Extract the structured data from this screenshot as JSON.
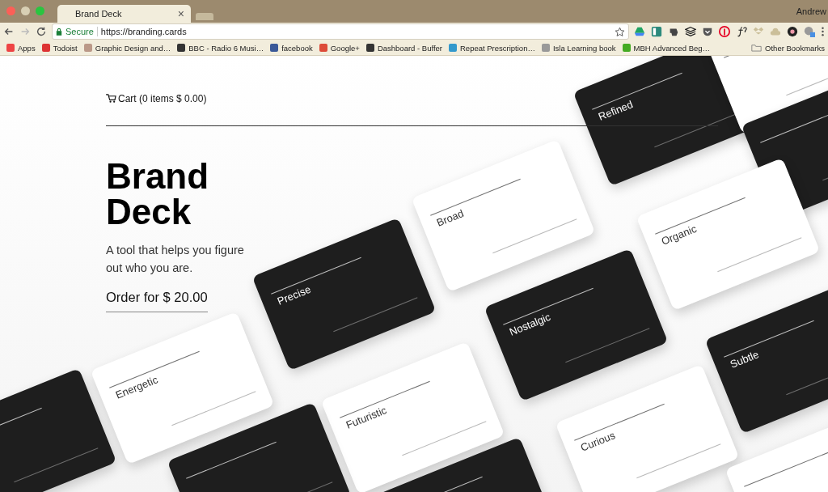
{
  "browser": {
    "tab_title": "Brand Deck",
    "tab_close": "×",
    "user": "Andrew",
    "secure_label": "Secure",
    "url": "https://branding.cards",
    "bookmarks": [
      {
        "label": "Apps"
      },
      {
        "label": "Todoist"
      },
      {
        "label": "Graphic Design and…"
      },
      {
        "label": "BBC - Radio 6 Musi…"
      },
      {
        "label": "facebook"
      },
      {
        "label": "Google+"
      },
      {
        "label": "Dashboard - Buffer"
      },
      {
        "label": "Repeat Prescription…"
      },
      {
        "label": "Isla Learning book"
      },
      {
        "label": "MBH Advanced Beg…"
      }
    ],
    "other_bookmarks": "Other Bookmarks"
  },
  "page": {
    "cart": "Cart (0 items $ 0.00)",
    "title_lines": [
      "Brand",
      "Deck"
    ],
    "tagline": "A tool that helps you figure out who you are.",
    "order": "Order for $ 20.00",
    "cards": [
      {
        "label": "Refined",
        "dark": true
      },
      {
        "dark": false
      },
      {
        "dark": true
      },
      {
        "label": "Broad",
        "dark": false
      },
      {
        "label": "Organic",
        "dark": false
      },
      {
        "label": "Precise",
        "dark": true
      },
      {
        "label": "Nostalgic",
        "dark": true
      },
      {
        "label": "Subtle",
        "dark": true
      },
      {
        "label": "Energetic",
        "dark": false
      },
      {
        "label": "Futuristic",
        "dark": false
      },
      {
        "label": "Curious",
        "dark": false
      },
      {
        "dark": true
      },
      {
        "dark": true
      },
      {
        "dark": true
      },
      {
        "dark": false
      }
    ]
  }
}
